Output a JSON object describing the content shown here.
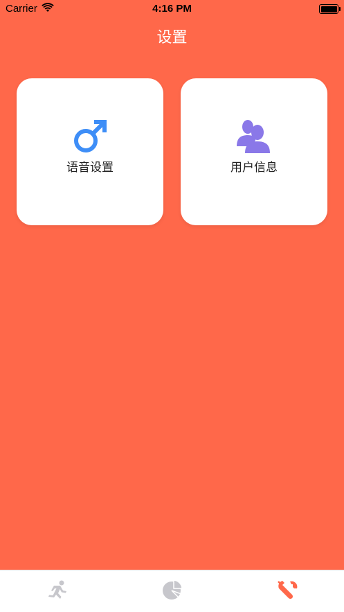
{
  "status_bar": {
    "carrier": "Carrier",
    "time": "4:16 PM"
  },
  "nav": {
    "title": "设置"
  },
  "cards": [
    {
      "label": "语音设置",
      "icon": "male-symbol-icon",
      "icon_color": "#3E8EF7"
    },
    {
      "label": "用户信息",
      "icon": "users-icon",
      "icon_color": "#8A78E8"
    }
  ],
  "tab_bar": {
    "items": [
      {
        "icon": "running-icon",
        "selected": false
      },
      {
        "icon": "pie-chart-icon",
        "selected": false
      },
      {
        "icon": "wrench-icon",
        "selected": true
      }
    ],
    "active_color": "#FF684A",
    "inactive_color": "#C7C7CC"
  },
  "colors": {
    "background": "#FF684A",
    "card": "#FFFFFF"
  }
}
